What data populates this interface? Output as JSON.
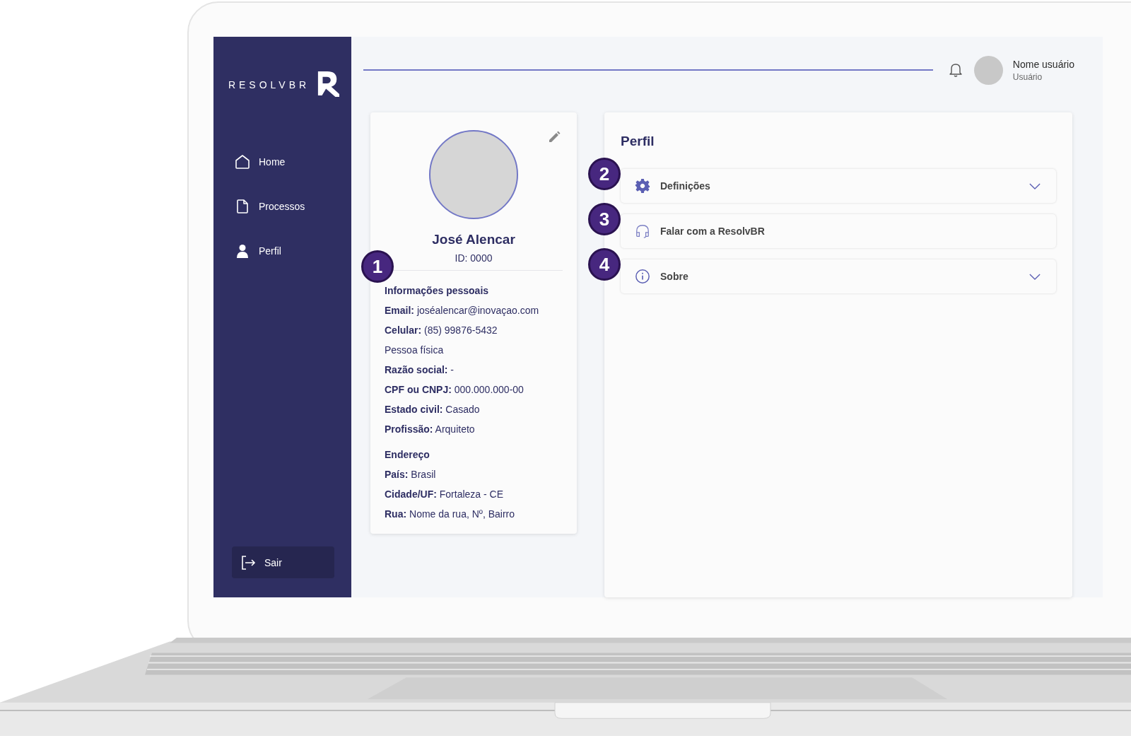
{
  "brand": {
    "wordmark": "RESOLVBR"
  },
  "sidebar": {
    "items": [
      {
        "label": "Home"
      },
      {
        "label": "Processos"
      },
      {
        "label": "Perfil"
      }
    ],
    "logout": {
      "label": "Sair"
    }
  },
  "header": {
    "user_name": "Nome usuário",
    "user_role": "Usuário"
  },
  "profile_card": {
    "marker": "1",
    "name": "José Alencar",
    "id": "ID: 0000",
    "sections": [
      {
        "title": "Informações pessoais",
        "lines": [
          "**Email:** joséalencar@inovaçao.com",
          "**Celular:** (85) 99876-5432",
          "Pessoa física",
          "**Razão social:** -",
          "**CPF ou CNPJ:** 000.000.000-00",
          "**Estado civil:** Casado",
          "**Profissão:** Arquiteto"
        ]
      },
      {
        "title": "Endereço",
        "lines": [
          "**País:** Brasil",
          "**Cidade/UF:** Fortaleza - CE",
          "**Rua:** Nome da rua, Nº, Bairro"
        ]
      }
    ]
  },
  "panel": {
    "title": "Perfil",
    "items": [
      {
        "marker": "2",
        "label": "Definições",
        "expandable": true
      },
      {
        "marker": "3",
        "label": "Falar com a ResolvBR",
        "expandable": false
      },
      {
        "marker": "4",
        "label": "Sobre",
        "expandable": true
      }
    ]
  }
}
